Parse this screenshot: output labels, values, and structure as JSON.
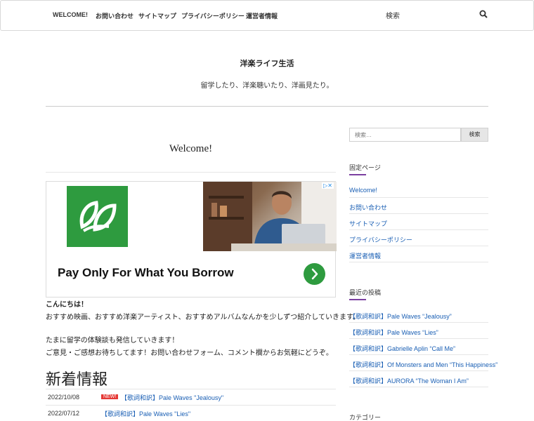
{
  "nav": {
    "items": [
      "WELCOME!",
      "お問い合わせ",
      "サイトマップ",
      "プライバシーポリシー",
      "運営者情報"
    ],
    "search_label": "検索"
  },
  "header": {
    "title": "洋楽ライフ生活",
    "description": "留学したり、洋楽聴いたり、洋画見たり。"
  },
  "post": {
    "title": "Welcome!",
    "paragraphs": [
      "こんにちは！",
      "おすすめ映画、おすすめ洋楽アーティスト、おすすめアルバムなんかを少しずつ紹介していきます。",
      "たまに留学の体験談も発信していきます！",
      "ご意見・ご感想お待ちしてます！お問い合わせフォーム、コメント欄からお気軽にどうぞ。"
    ]
  },
  "ad": {
    "badge": "▷✕",
    "headline": "Pay Only For What You Borrow"
  },
  "news": {
    "heading": "新着情報",
    "items": [
      {
        "date": "2022/10/08",
        "badge": "NEW!",
        "title": "【歌詞和訳】Pale Waves \"Jealousy\""
      },
      {
        "date": "2022/07/12",
        "badge": "",
        "title": "【歌詞和訳】Pale Waves \"Lies\""
      }
    ]
  },
  "sidebar": {
    "search_placeholder": "検索…",
    "search_button": "検索",
    "fixed_pages_heading": "固定ページ",
    "fixed_pages": [
      "Welcome!",
      "お問い合わせ",
      "サイトマップ",
      "プライバシーポリシー",
      "運営者情報"
    ],
    "recent_heading": "最近の投稿",
    "recent_posts": [
      "【歌詞和訳】Pale Waves “Jealousy”",
      "【歌詞和訳】Pale Waves “Lies”",
      "【歌詞和訳】Gabrielle Aplin “Call Me”",
      "【歌詞和訳】Of Monsters and Men “This Happiness”",
      "【歌詞和訳】AURORA “The Woman I Am”"
    ],
    "category_heading": "カテゴリー"
  },
  "colors": {
    "link": "#1a5fb4",
    "accent_underline": "#7b3fa0",
    "ad_green": "#2e9b3f",
    "new_badge": "#e53935"
  }
}
